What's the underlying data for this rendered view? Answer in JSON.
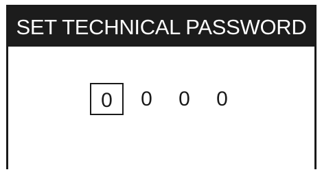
{
  "screen": {
    "title": "SET TECHNICAL PASSWORD"
  },
  "password": {
    "digits": [
      "0",
      "0",
      "0",
      "0"
    ],
    "selected_index": 0
  }
}
